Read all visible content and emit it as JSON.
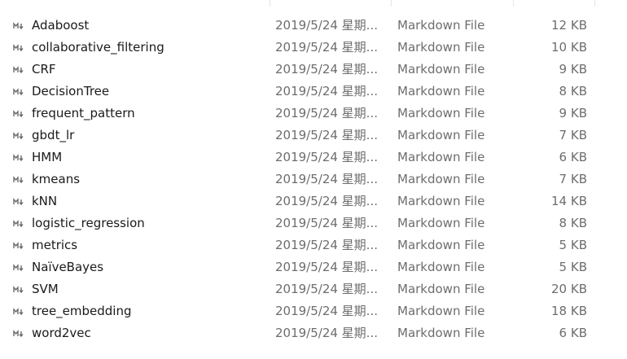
{
  "file_list": {
    "icon": "markdown-file-icon",
    "rows": [
      {
        "name": "Adaboost",
        "date": "2019/5/24 星期...",
        "type": "Markdown File",
        "size": "12 KB"
      },
      {
        "name": "collaborative_filtering",
        "date": "2019/5/24 星期...",
        "type": "Markdown File",
        "size": "10 KB"
      },
      {
        "name": "CRF",
        "date": "2019/5/24 星期...",
        "type": "Markdown File",
        "size": "9 KB"
      },
      {
        "name": "DecisionTree",
        "date": "2019/5/24 星期...",
        "type": "Markdown File",
        "size": "8 KB"
      },
      {
        "name": "frequent_pattern",
        "date": "2019/5/24 星期...",
        "type": "Markdown File",
        "size": "9 KB"
      },
      {
        "name": "gbdt_lr",
        "date": "2019/5/24 星期...",
        "type": "Markdown File",
        "size": "7 KB"
      },
      {
        "name": "HMM",
        "date": "2019/5/24 星期...",
        "type": "Markdown File",
        "size": "6 KB"
      },
      {
        "name": "kmeans",
        "date": "2019/5/24 星期...",
        "type": "Markdown File",
        "size": "7 KB"
      },
      {
        "name": "kNN",
        "date": "2019/5/24 星期...",
        "type": "Markdown File",
        "size": "14 KB"
      },
      {
        "name": "logistic_regression",
        "date": "2019/5/24 星期...",
        "type": "Markdown File",
        "size": "8 KB"
      },
      {
        "name": "metrics",
        "date": "2019/5/24 星期...",
        "type": "Markdown File",
        "size": "5 KB"
      },
      {
        "name": "NaïveBayes",
        "date": "2019/5/24 星期...",
        "type": "Markdown File",
        "size": "5 KB"
      },
      {
        "name": "SVM",
        "date": "2019/5/24 星期...",
        "type": "Markdown File",
        "size": "20 KB"
      },
      {
        "name": "tree_embedding",
        "date": "2019/5/24 星期...",
        "type": "Markdown File",
        "size": "18 KB"
      },
      {
        "name": "word2vec",
        "date": "2019/5/24 星期...",
        "type": "Markdown File",
        "size": "6 KB"
      }
    ]
  }
}
